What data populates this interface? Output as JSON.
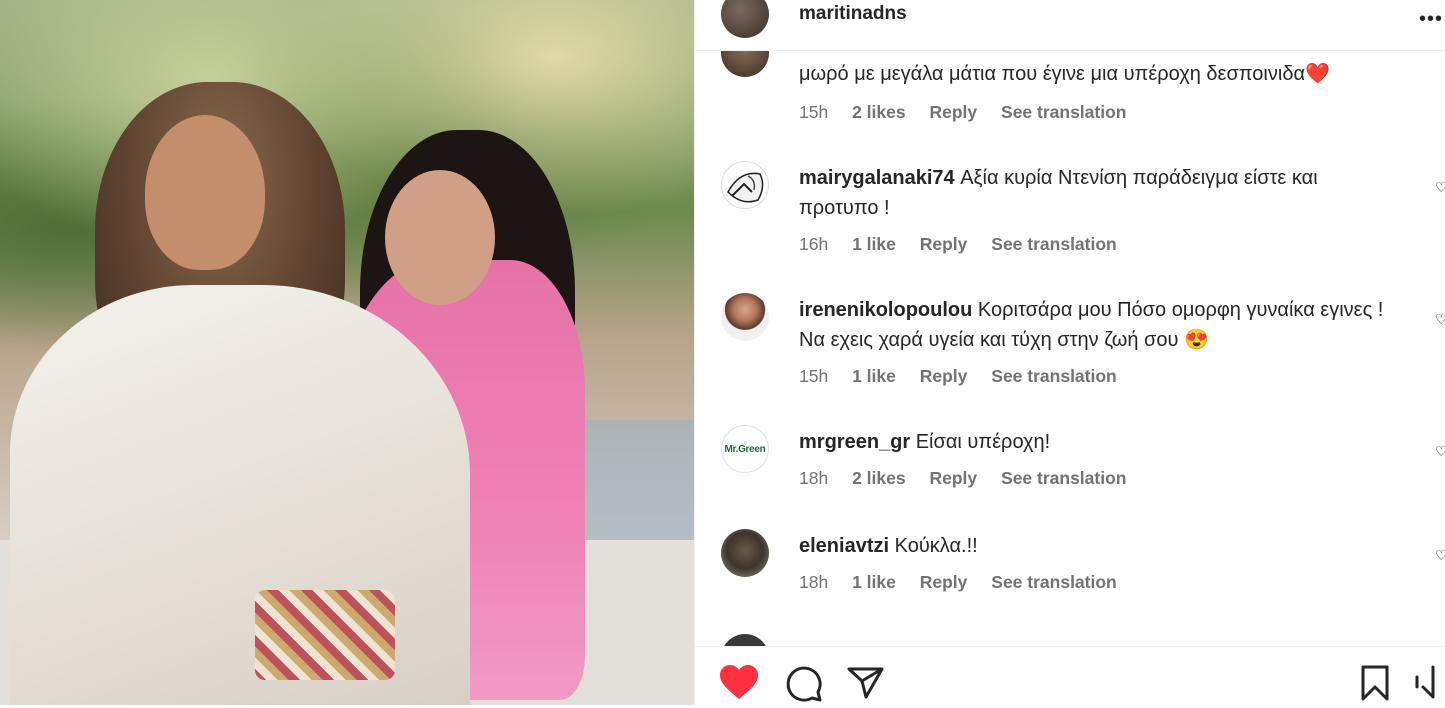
{
  "post": {
    "username": "maritinadns"
  },
  "comments": [
    {
      "username": "",
      "text": "μωρό με μεγάλα μάτια που έγινε μια υπέροχη δεσποινιδα❤️",
      "time": "15h",
      "likes": "2 likes",
      "reply": "Reply",
      "translate": "See translation"
    },
    {
      "username": "mairygalanaki74",
      "text": "Αξία κυρία Ντενίση παράδειγμα είστε και προτυπο !",
      "time": "16h",
      "likes": "1 like",
      "reply": "Reply",
      "translate": "See translation"
    },
    {
      "username": "irenenikolopoulou",
      "text": "Κοριτσάρα μου Πόσο ομορφη γυναίκα εγινες ! Να εχεις χαρά υγεία και τύχη στην ζωή σου 😍",
      "time": "15h",
      "likes": "1 like",
      "reply": "Reply",
      "translate": "See translation"
    },
    {
      "username": "mrgreen_gr",
      "text": "Είσαι υπέροχη!",
      "time": "18h",
      "likes": "2 likes",
      "reply": "Reply",
      "translate": "See translation"
    },
    {
      "username": "eleniavtzi",
      "text": "Κούκλα.!!",
      "time": "18h",
      "likes": "1 like",
      "reply": "Reply",
      "translate": "See translation"
    }
  ],
  "avatar_labels": {
    "mrgreen": "Mr.Green"
  },
  "icons": {
    "like": "heart-filled-icon",
    "comment": "comment-icon",
    "share": "send-icon",
    "save": "bookmark-icon",
    "more": "more-horizontal-icon"
  },
  "colors": {
    "like_red": "#ff3040",
    "text": "#262626",
    "muted": "#737373"
  }
}
